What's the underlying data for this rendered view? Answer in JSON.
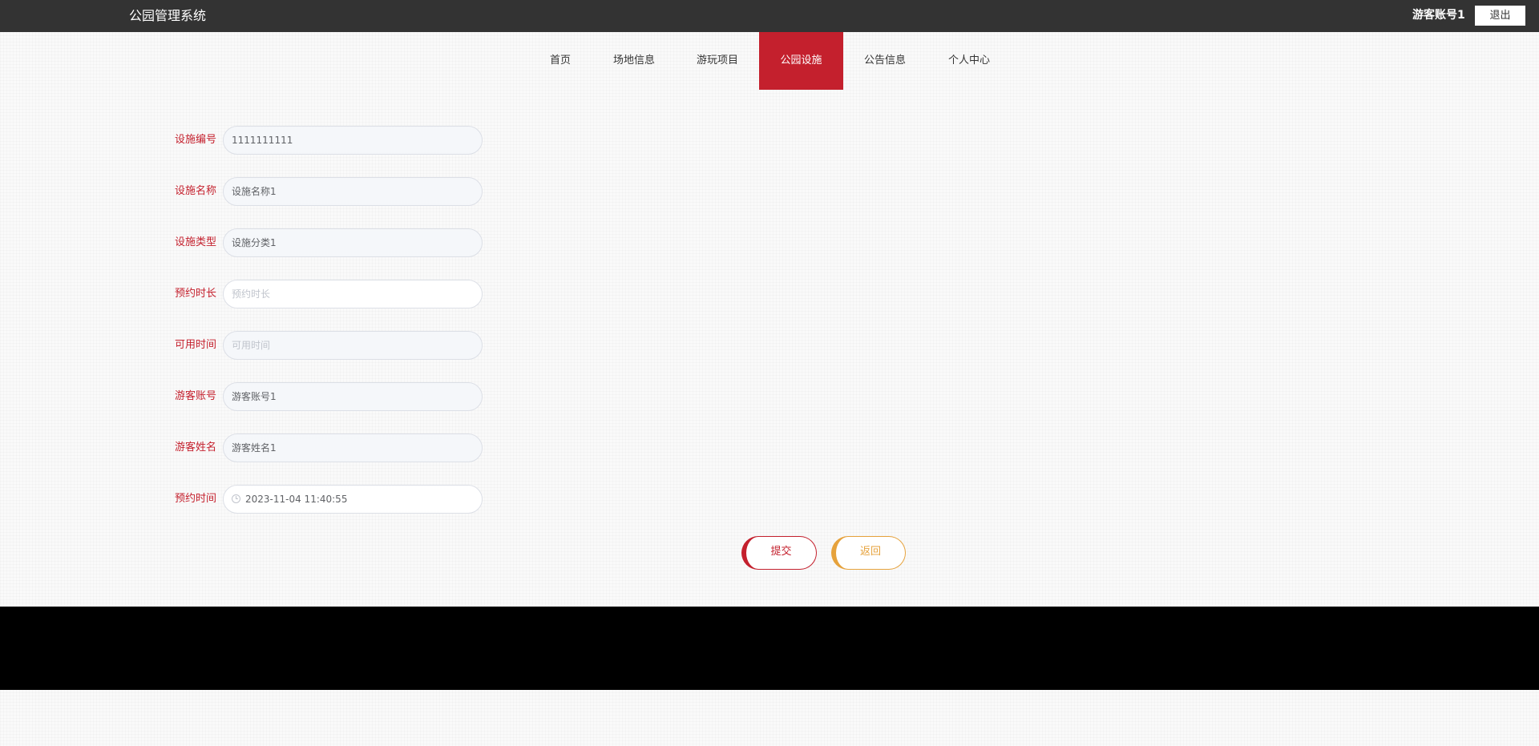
{
  "header": {
    "title": "公园管理系统",
    "user": "游客账号1",
    "logout_label": "退出"
  },
  "nav": {
    "items": [
      {
        "label": "首页"
      },
      {
        "label": "场地信息"
      },
      {
        "label": "游玩项目"
      },
      {
        "label": "公园设施",
        "active": true
      },
      {
        "label": "公告信息"
      },
      {
        "label": "个人中心"
      }
    ]
  },
  "form": {
    "fields": [
      {
        "label": "设施编号",
        "value": "1111111111",
        "placeholder": ""
      },
      {
        "label": "设施名称",
        "value": "设施名称1",
        "placeholder": ""
      },
      {
        "label": "设施类型",
        "value": "设施分类1",
        "placeholder": ""
      },
      {
        "label": "预约时长",
        "value": "",
        "placeholder": "预约时长"
      },
      {
        "label": "可用时间",
        "value": "",
        "placeholder": "可用时间"
      },
      {
        "label": "游客账号",
        "value": "游客账号1",
        "placeholder": ""
      },
      {
        "label": "游客姓名",
        "value": "游客姓名1",
        "placeholder": ""
      },
      {
        "label": "预约时间",
        "value": "2023-11-04 11:40:55",
        "placeholder": "",
        "icon": "clock-icon"
      }
    ],
    "submit_label": "提交",
    "back_label": "返回"
  },
  "colors": {
    "accent": "#c4202d",
    "secondary": "#e6a23c",
    "topbar": "#333333",
    "footer": "#000000"
  }
}
